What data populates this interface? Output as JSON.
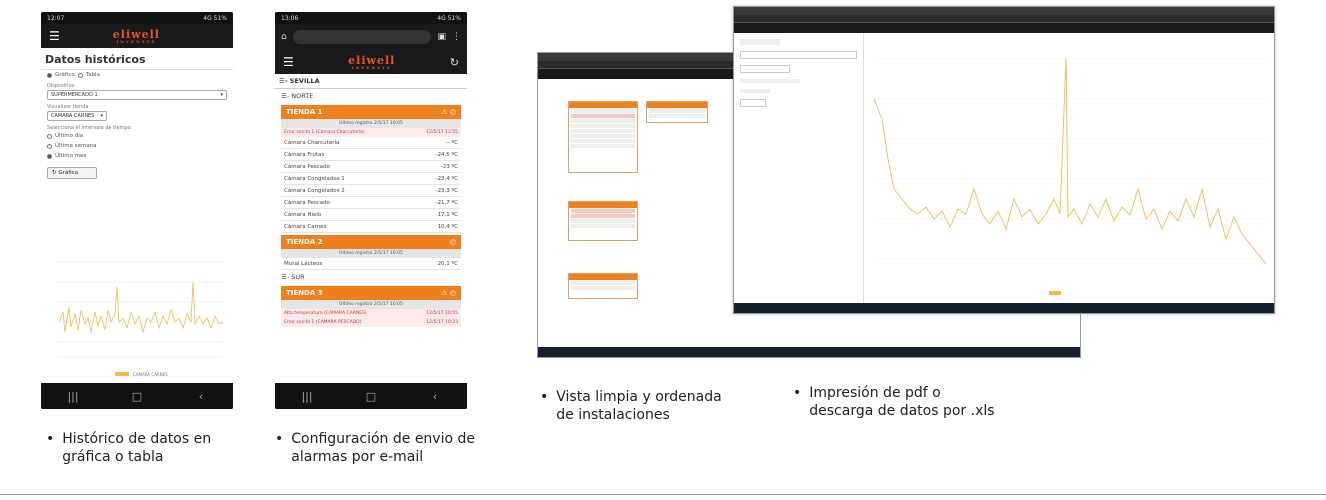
{
  "phone1": {
    "status_time": "12:07",
    "status_right": "4G 51%",
    "title": "Datos históricos",
    "view_options": [
      "Gráfico",
      "Tabla"
    ],
    "device_label": "Dispositivo",
    "device_value": "SUPERMERCADO 1",
    "probe_label": "Visualizar tienda",
    "probe_value": "CAMARA CARNES",
    "interval_label": "Selecciona el intervalo de tiempo.",
    "interval_options": [
      "Último día",
      "Última semana",
      "Último mes"
    ],
    "button_label": "Gráfico",
    "chart_legend": "CAMARA CARNES"
  },
  "phone2": {
    "status_time": "13:06",
    "status_right": "4G 51%",
    "region": "SEVILLA",
    "zone_north": "NORTE",
    "zone_south": "SUR",
    "store1": {
      "name": "TIENDA 1",
      "last_record": "Último registro 2/5/17 10:05",
      "alarm_text": "Error sonda 1 (Cámara Charcutería)",
      "alarm_time": "12/5/17 13:55",
      "cameras": [
        {
          "name": "Cámara Charcutería",
          "value": "-- ºC"
        },
        {
          "name": "Cámara Frutas",
          "value": "-24,5 ºC"
        },
        {
          "name": "Cámara Pescado",
          "value": "-23 ºC"
        },
        {
          "name": "Cámara Congelados 1",
          "value": "-23,4 ºC"
        },
        {
          "name": "Cámara Congelados 2",
          "value": "-23,3 ºC"
        },
        {
          "name": "Cámara Pescado",
          "value": "-21,7 ºC"
        },
        {
          "name": "Cámara Hielo",
          "value": "17,1 ºC"
        },
        {
          "name": "Cámara Carnes",
          "value": "10,4 ºC"
        }
      ]
    },
    "store2": {
      "name": "TIENDA 2",
      "last_record": "Último registro 2/5/17 10:05",
      "cameras": [
        {
          "name": "Mural Lácteos",
          "value": "20,1 ºC"
        }
      ]
    },
    "store3": {
      "name": "TIENDA 3",
      "last_record": "Último registro 2/5/17 10:05",
      "alarms": [
        {
          "text": "Alta temperatura (CAMARA CARNES)",
          "time": "12/5/17 10:55"
        },
        {
          "text": "Error sonda 1 (CAMARA PESCADO)",
          "time": "12/5/17 10:23"
        }
      ]
    }
  },
  "captions": {
    "c1": [
      "Histórico de datos en",
      "gráfica o tabla"
    ],
    "c2": [
      "Configuración de envio de",
      "alarmas por e-mail"
    ],
    "c3": [
      "Vista limpia y ordenada",
      "de instalaciones"
    ],
    "c4": [
      "Impresión de pdf o",
      "descarga de datos por .xls"
    ]
  },
  "colors": {
    "accent": "#f0801e",
    "line": "#f5b94a",
    "dark": "#1a1a1a"
  }
}
